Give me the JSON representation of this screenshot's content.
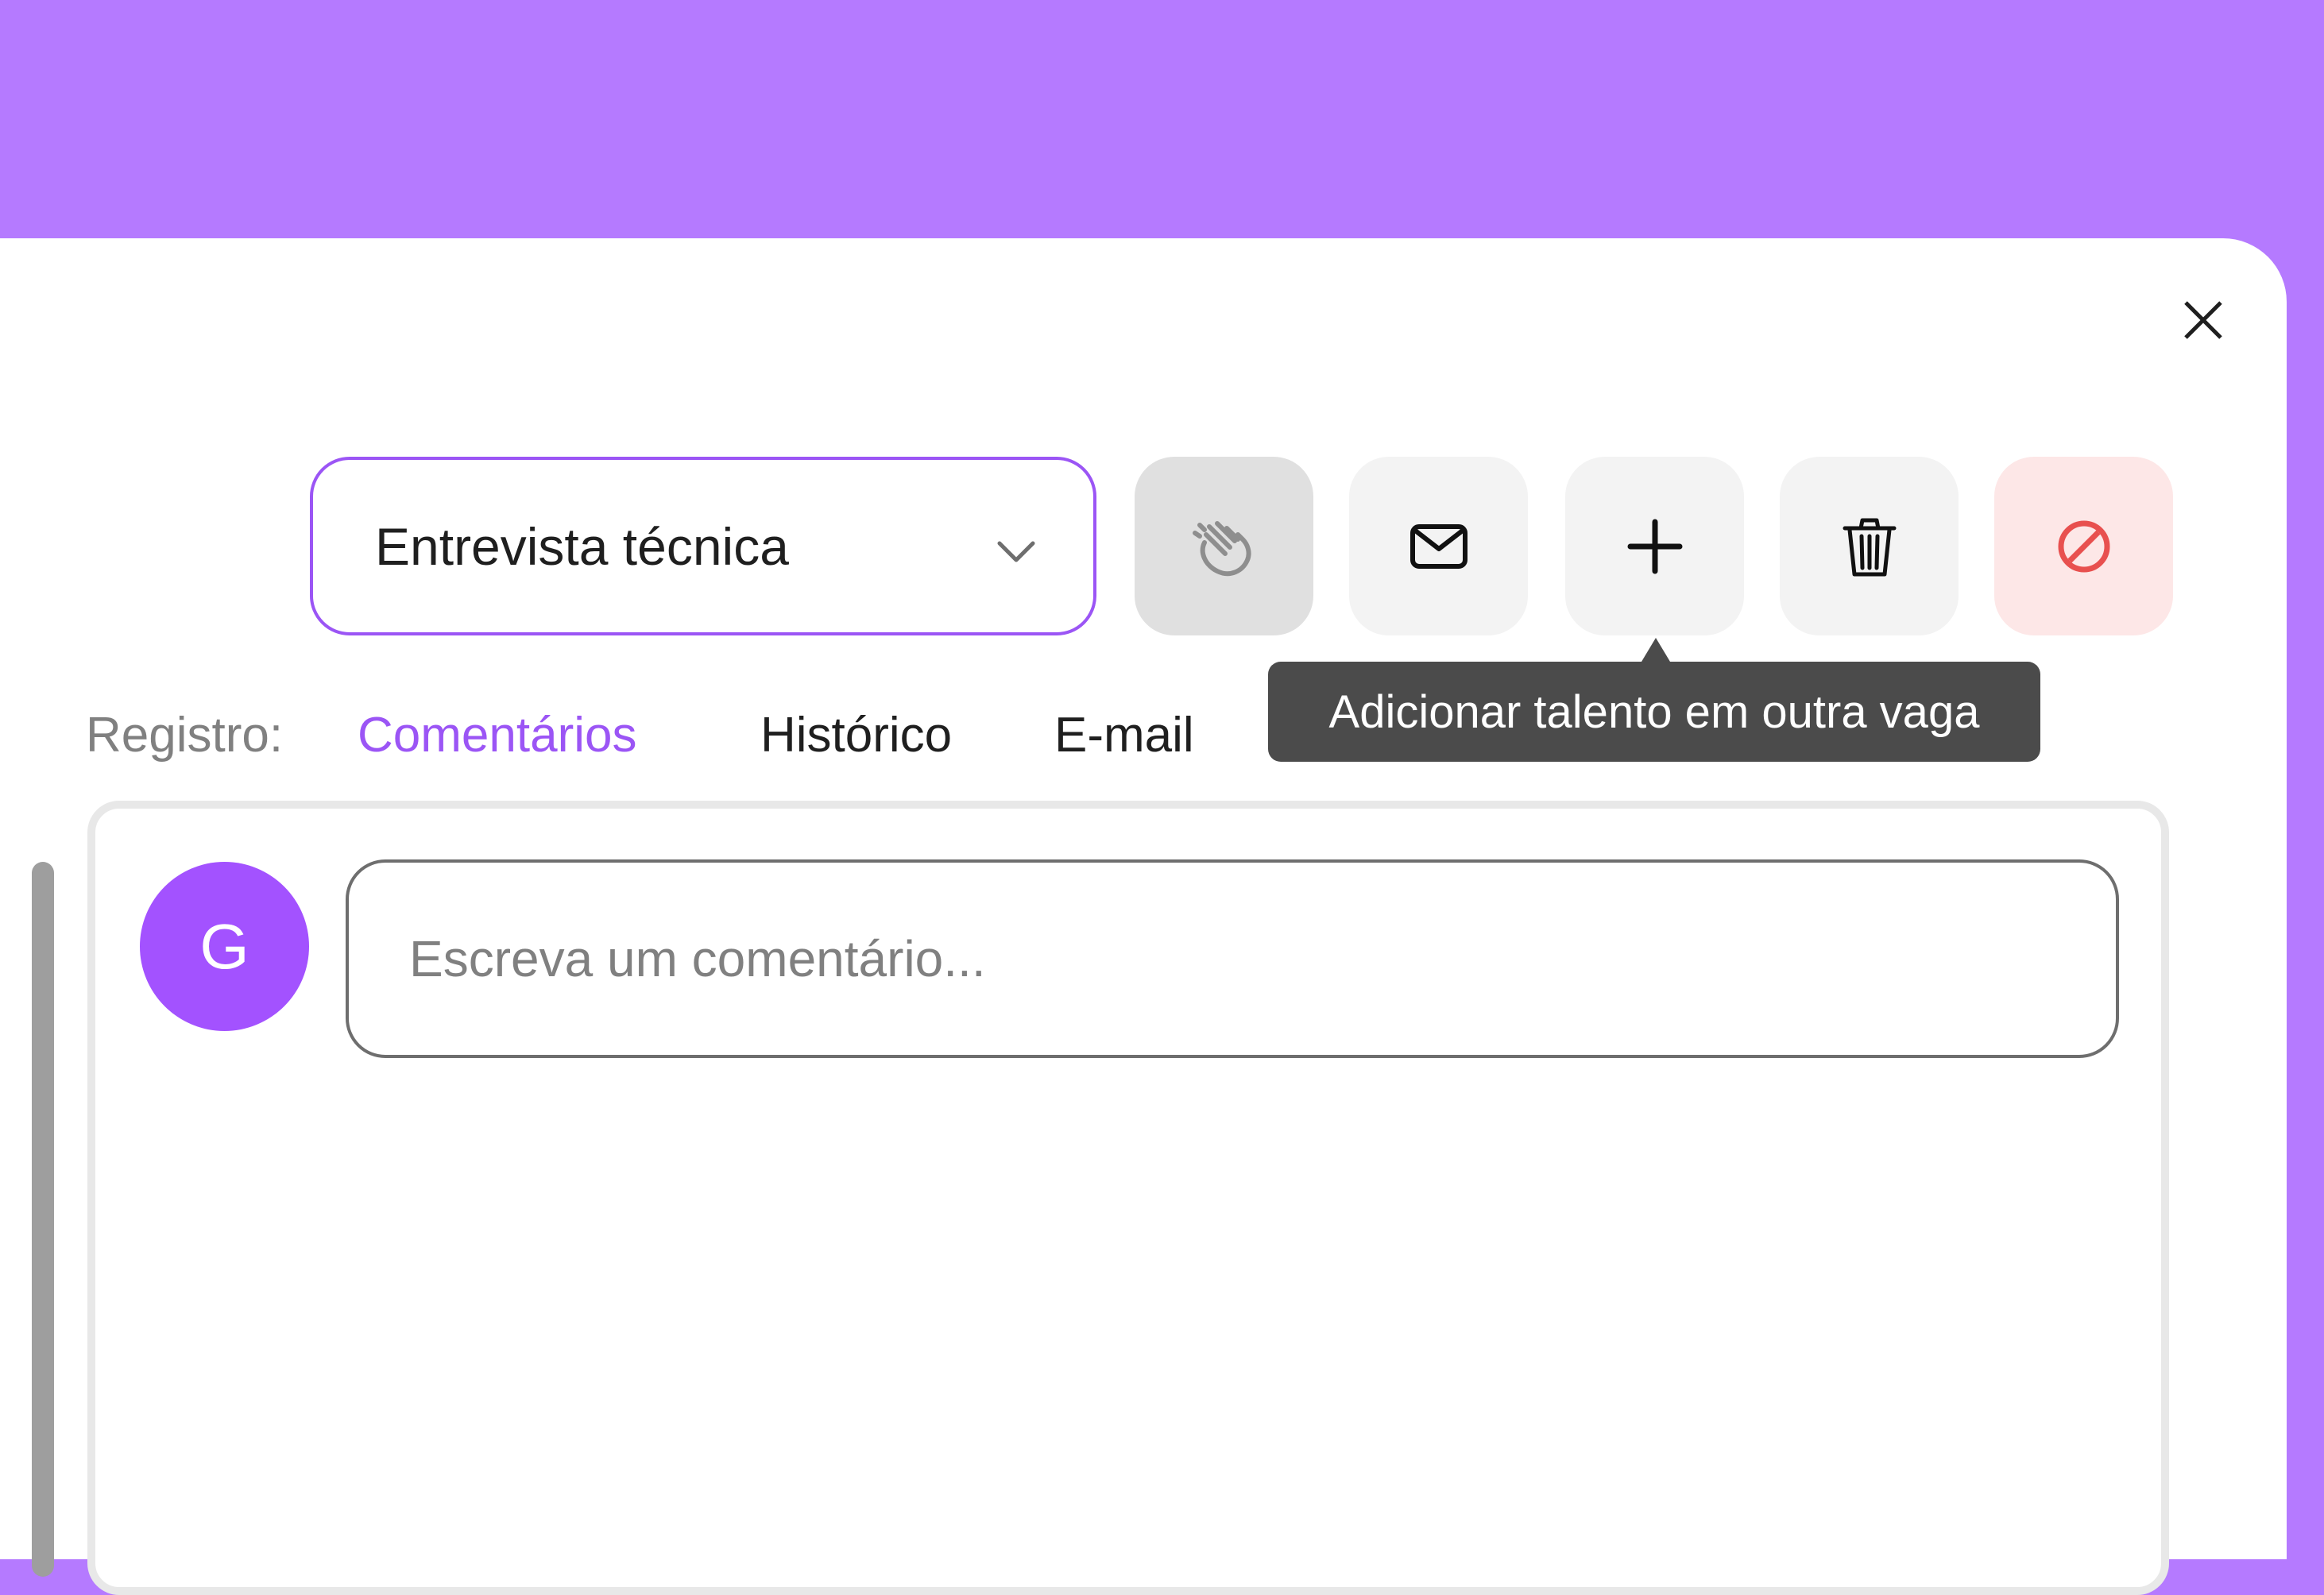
{
  "colors": {
    "background": "#b57aff",
    "accent": "#9b55f5",
    "avatar": "#a352ff",
    "tooltip_bg": "#4b4b4b",
    "danger_bg": "#fde7e7",
    "danger_icon": "#e8504f"
  },
  "header": {
    "close_label": "X"
  },
  "stage_select": {
    "value": "Entrevista técnica",
    "icon": "chevron-down-icon"
  },
  "actions": [
    {
      "icon": "wave-hand-icon"
    },
    {
      "icon": "mail-icon"
    },
    {
      "icon": "plus-icon"
    },
    {
      "icon": "trash-icon"
    },
    {
      "icon": "block-icon"
    }
  ],
  "tooltip": {
    "text": "Adicionar talento em outra vaga"
  },
  "tabs": {
    "label": "Registro:",
    "items": [
      "Comentários",
      "Histórico",
      "E-mail"
    ],
    "active": "Comentários"
  },
  "comments": {
    "avatar_initial": "G",
    "input_placeholder": "Escreva um comentário..."
  }
}
